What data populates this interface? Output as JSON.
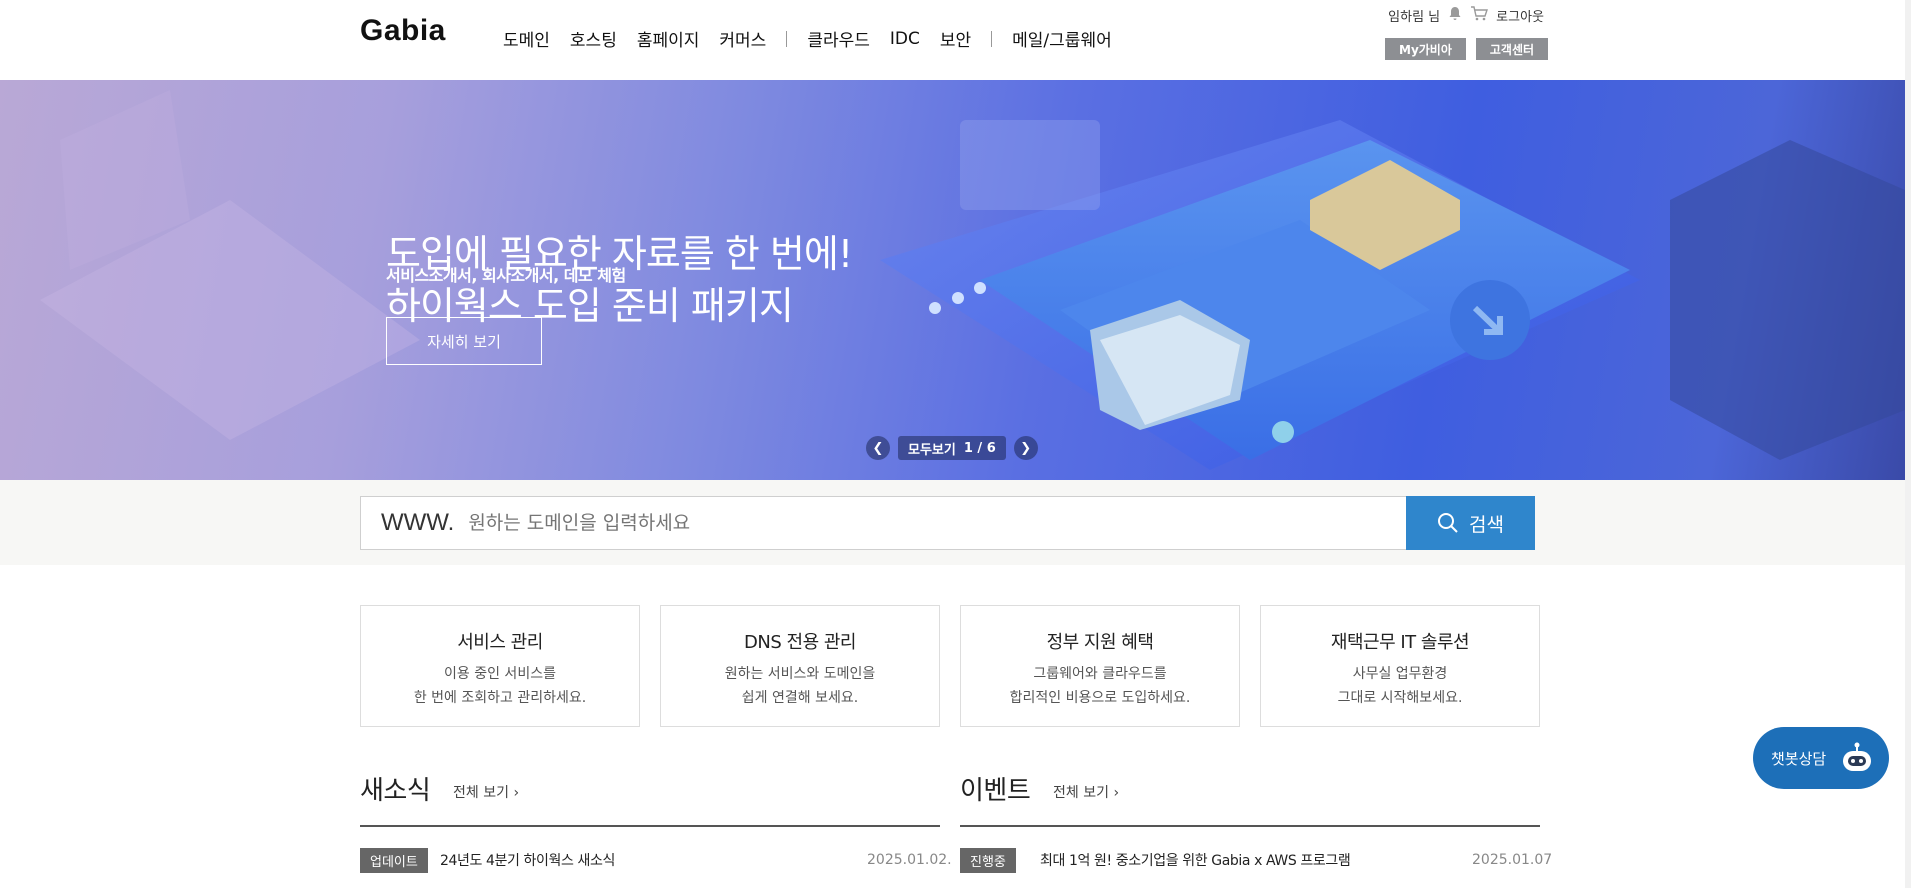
{
  "header": {
    "logo": "Gabia",
    "nav": [
      "도메인",
      "호스팅",
      "홈페이지",
      "커머스",
      "클라우드",
      "IDC",
      "보안",
      "메일/그룹웨어"
    ],
    "user_name": "임하림 님",
    "logout": "로그아웃",
    "my_gabia": "My가비아",
    "support": "고객센터"
  },
  "hero": {
    "title_line1": "도입에 필요한 자료를 한 번에!",
    "title_line2": "하이웍스 도입 준비 패키지",
    "subtitle": "서비스소개서, 회사소개서, 데모 체험",
    "button": "자세히 보기",
    "view_all": "모두보기",
    "pager": "1 / 6"
  },
  "search": {
    "prefix": "WWW.",
    "placeholder": "원하는 도메인을 입력하세요",
    "button": "검색"
  },
  "cards": [
    {
      "title": "서비스 관리",
      "line1": "이용 중인 서비스를",
      "line2": "한 번에 조회하고 관리하세요."
    },
    {
      "title": "DNS 전용 관리",
      "line1": "원하는 서비스와 도메인을",
      "line2": "쉽게 연결해 보세요."
    },
    {
      "title": "정부 지원 혜택",
      "line1": "그룹웨어와 클라우드를",
      "line2": "합리적인 비용으로 도입하세요."
    },
    {
      "title": "재택근무 IT 솔루션",
      "line1": "사무실 업무환경",
      "line2": "그대로 시작해보세요."
    }
  ],
  "news": {
    "title": "새소식",
    "more": "전체 보기",
    "item": {
      "tag": "업데이트",
      "text": "24년도 4분기 하이웍스 새소식",
      "date": "2025.01.02."
    }
  },
  "events": {
    "title": "이벤트",
    "more": "전체 보기",
    "item": {
      "tag": "진행중",
      "text": "최대 1억 원! 중소기업을 위한 Gabia x AWS 프로그램",
      "date": "2025.01.07"
    }
  },
  "chatbot": {
    "label": "챗봇상담"
  },
  "colors": {
    "accent": "#2f86cc",
    "chatbot": "#1d6fb8",
    "tag": "#666666"
  }
}
